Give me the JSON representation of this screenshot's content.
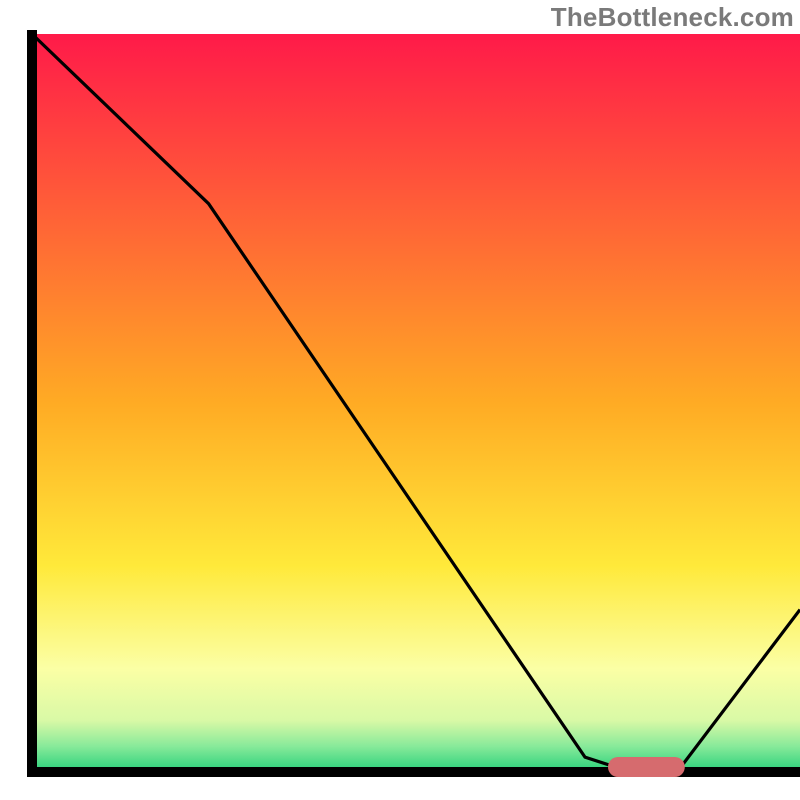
{
  "watermark": "TheBottleneck.com",
  "chart_data": {
    "type": "line",
    "title": "",
    "xlabel": "",
    "ylabel": "",
    "xlim": [
      0,
      100
    ],
    "ylim": [
      0,
      100
    ],
    "series": [
      {
        "name": "bottleneck-curve",
        "x": [
          0,
          23,
          72,
          78,
          84,
          100
        ],
        "values": [
          100,
          77,
          2,
          0,
          0,
          22
        ]
      }
    ],
    "marker": {
      "name": "optimal-range",
      "x_start": 75,
      "x_end": 85,
      "y": 0,
      "color": "#d66b6e"
    },
    "background_gradient": {
      "stops": [
        {
          "offset": 0.0,
          "color": "#ff1a49"
        },
        {
          "offset": 0.5,
          "color": "#ffab24"
        },
        {
          "offset": 0.72,
          "color": "#ffe93a"
        },
        {
          "offset": 0.86,
          "color": "#fbffa5"
        },
        {
          "offset": 0.93,
          "color": "#d9f9a6"
        },
        {
          "offset": 0.965,
          "color": "#88ea9a"
        },
        {
          "offset": 1.0,
          "color": "#27d07a"
        }
      ]
    }
  }
}
